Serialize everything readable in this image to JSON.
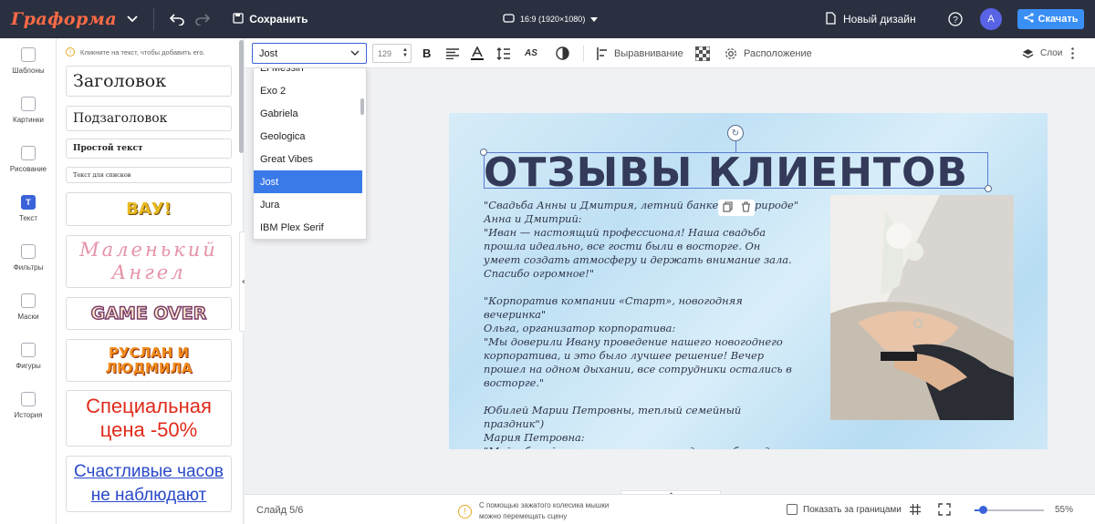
{
  "header": {
    "logo": "Граформа",
    "save_label": "Сохранить",
    "canvas_size": "16:9 (1920×1080)",
    "new_design_label": "Новый дизайн",
    "avatar_initial": "A",
    "download_label": "Скачать"
  },
  "leftnav": {
    "items": [
      {
        "label": "Шаблоны",
        "icon": "templates-icon"
      },
      {
        "label": "Картинки",
        "icon": "images-icon"
      },
      {
        "label": "Рисование",
        "icon": "draw-icon"
      },
      {
        "label": "Текст",
        "icon": "text-icon",
        "glyph": "T"
      },
      {
        "label": "Фильтры",
        "icon": "filters-icon"
      },
      {
        "label": "Маски",
        "icon": "masks-icon"
      },
      {
        "label": "Фигуры",
        "icon": "shapes-icon"
      },
      {
        "label": "История",
        "icon": "history-icon"
      }
    ],
    "active_index": 3
  },
  "textpanel": {
    "hint": "Кликните на текст, чтобы добавить его.",
    "presets": [
      {
        "text": "Заголовок"
      },
      {
        "text": "Подзаголовок"
      },
      {
        "text": "Простой текст"
      },
      {
        "text": "Текст для списков"
      },
      {
        "text": "ВАУ!"
      },
      {
        "text": "Маленький Ангел"
      },
      {
        "text": "GAME OVER"
      },
      {
        "text": "РУСЛАН И ЛЮДМИЛА"
      },
      {
        "text": "Специальная цена -50%"
      },
      {
        "text": "Счастливые часов не наблюдают"
      }
    ]
  },
  "toolbar": {
    "font": "Jost",
    "font_size": "129",
    "bold_label": "B",
    "align_label": "Выравнивание",
    "arrange_label": "Расположение",
    "layers_label": "Слои"
  },
  "font_dropdown": {
    "items": [
      "El Messiri",
      "Exo 2",
      "Gabriela",
      "Geologica",
      "Great Vibes",
      "Jost",
      "Jura",
      "IBM Plex Serif"
    ],
    "selected": "Jost"
  },
  "slide": {
    "title": "ОТЗЫВЫ КЛИЕНТОВ",
    "reviews": [
      "\"Свадьба Анны и Дмитрия, летний банкет на природе\"\nАнна и Дмитрий:\n\"Иван — настоящий профессионал! Наша свадьба прошла идеально, все гости были в восторге. Он умеет создать атмосферу и держать внимание зала. Спасибо огромное!\"",
      "\"Корпоратив компании «Старт», новогодняя вечеринка\"\nОльга, организатор корпоратива:\n\"Мы доверили Ивану проведение нашего новогоднего корпоратива, и это было лучшее решение! Вечер прошел на одном дыхании, все сотрудники остались в восторге.\"",
      "Юбилей Марии Петровны, теплый семейный праздник\")\nМария Петровна:\n\"Мой юбилей стал настоящим праздником благодаря Ивану. Он нашел подход ко всем гостям, и мы веселились от души. Спасибо за теплую атмосферу!\""
    ]
  },
  "bottombar": {
    "slide_counter": "Слайд 5/6",
    "tip_line1": "С помощью зажатого колесика мышки",
    "tip_line2": "можно перемещать сцену",
    "show_outside_label": "Показать за границами",
    "zoom_value": "55%",
    "zoom_fraction": 0.12
  },
  "colors": {
    "topbar": "#2a3040",
    "accent": "#3a63d9",
    "download": "#3a8ff5",
    "logo": "#ff6a45"
  }
}
